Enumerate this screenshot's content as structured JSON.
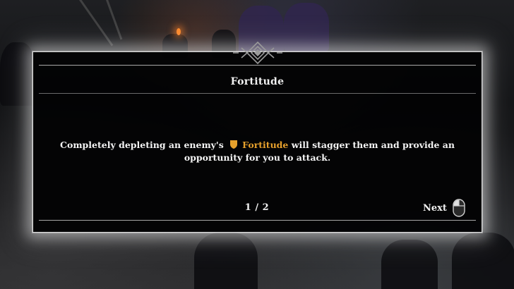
{
  "dialog": {
    "title": "Fortitude",
    "body_before": "Completely depleting an enemy's",
    "keyword": "Fortitude",
    "body_after": "will stagger them and provide an opportunity for you to attack.",
    "pagination": "1 / 2",
    "next_label": "Next"
  },
  "icons": {
    "keyword_icon": "fortitude-shield-icon",
    "next_icon": "mouse-left-click-icon",
    "header_icon": "ornament-emblem-icon"
  },
  "colors": {
    "keyword": "#e6a02c",
    "text": "#f4f4f4",
    "panel": "#030304",
    "border": "#d9d9d9"
  }
}
